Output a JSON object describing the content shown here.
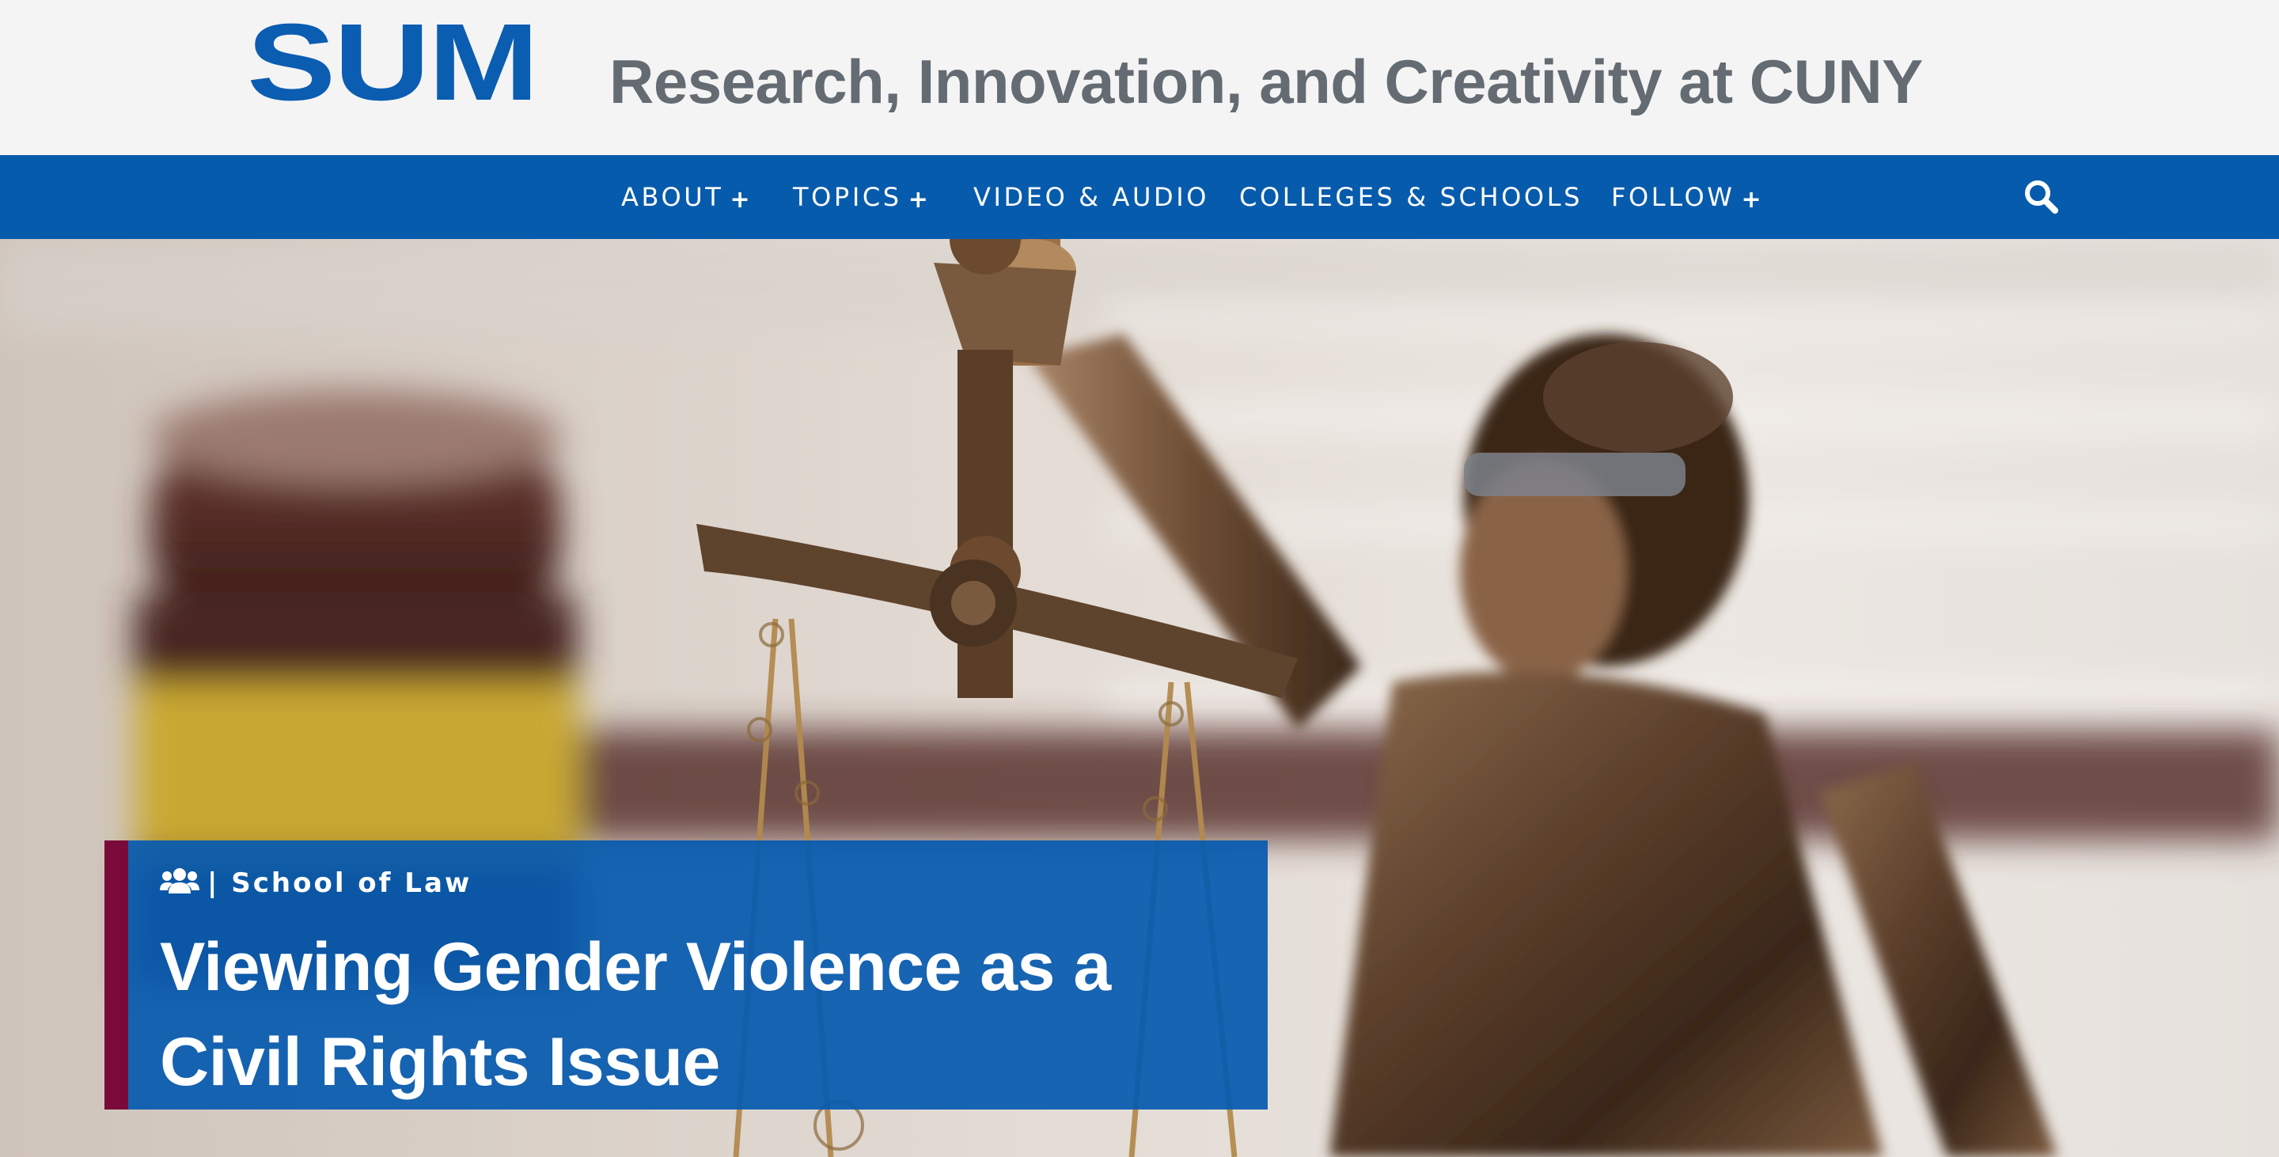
{
  "header": {
    "logo": "SUM",
    "tagline": "Research, Innovation, and Creativity at CUNY"
  },
  "nav": {
    "items": [
      {
        "label": "ABOUT",
        "has_submenu": true
      },
      {
        "label": "TOPICS",
        "has_submenu": true
      },
      {
        "label": "VIDEO & AUDIO",
        "has_submenu": false
      },
      {
        "label": "COLLEGES & SCHOOLS",
        "has_submenu": false
      },
      {
        "label": "FOLLOW",
        "has_submenu": true
      }
    ],
    "submenu_glyph": "+",
    "search_icon": "search-icon"
  },
  "feature": {
    "category_icon": "users-icon",
    "category": "| School of Law",
    "title": "Viewing Gender Violence as a Civil Rights Issue",
    "hero_image": "lady-justice-statue-with-gavel"
  },
  "colors": {
    "header_bg": "#f4f4f4",
    "brand_blue": "#0b5db1",
    "nav_bg": "#075bad",
    "tagline_gray": "#646b72",
    "accent_maroon": "#7a0a3a",
    "white": "#ffffff"
  }
}
